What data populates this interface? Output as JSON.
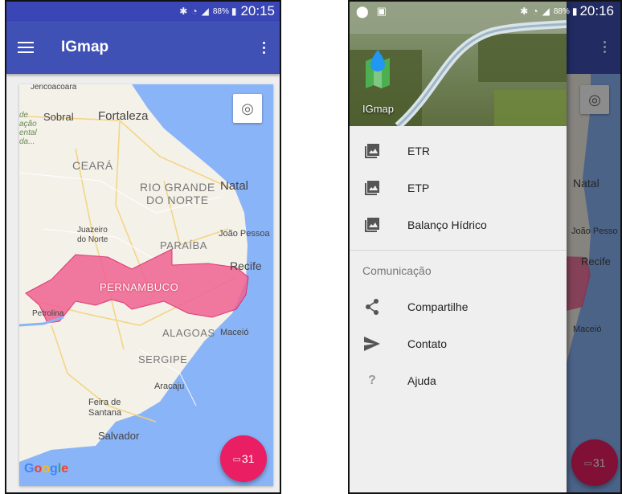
{
  "left_screen": {
    "status": {
      "battery": "88%",
      "time": "20:15"
    },
    "appbar": {
      "title": "IGmap"
    },
    "map": {
      "labels": {
        "jericoacoara": "Jericoacoara",
        "sobral": "Sobral",
        "fortaleza": "Fortaleza",
        "ceara": "CEARÁ",
        "rio_grande": "RIO GRANDE",
        "do_norte": "DO NORTE",
        "natal": "Natal",
        "juazeiro": "Juazeiro",
        "do_norte_city": "do Norte",
        "joao_pessoa": "João Pessoa",
        "paraiba": "PARAÍBA",
        "recife": "Recife",
        "pernambuco": "PERNAMBUCO",
        "petrolina": "Petrolina",
        "alagoas": "ALAGOAS",
        "maceio": "Maceió",
        "sergipe": "SERGIPE",
        "aracaju": "Aracaju",
        "feira": "Feira de",
        "santana": "Santana",
        "salvador": "Salvador",
        "area_text": "de\nação\nental\nda..."
      },
      "google": "Google"
    },
    "fab_day": "31"
  },
  "right_screen": {
    "status": {
      "battery": "88%",
      "time": "20:16"
    },
    "drawer_title": "IGmap",
    "menu": [
      {
        "label": "ETR",
        "icon": "image-icon"
      },
      {
        "label": "ETP",
        "icon": "image-icon"
      },
      {
        "label": "Balanço Hídrico",
        "icon": "image-icon"
      }
    ],
    "section": "Comunicação",
    "menu2": [
      {
        "label": "Compartilhe",
        "icon": "share-icon"
      },
      {
        "label": "Contato",
        "icon": "send-icon"
      },
      {
        "label": "Ajuda",
        "icon": "help-icon"
      }
    ],
    "bg_labels": {
      "natal": "Natal",
      "joao_pessoa": "João Pesso",
      "recife": "Recife",
      "maceio": "Maceió"
    },
    "fab_day": "31"
  },
  "colors": {
    "primary": "#3f51b5",
    "accent": "#e91e63",
    "highlight": "#f06292",
    "water": "#8ab4f8"
  }
}
